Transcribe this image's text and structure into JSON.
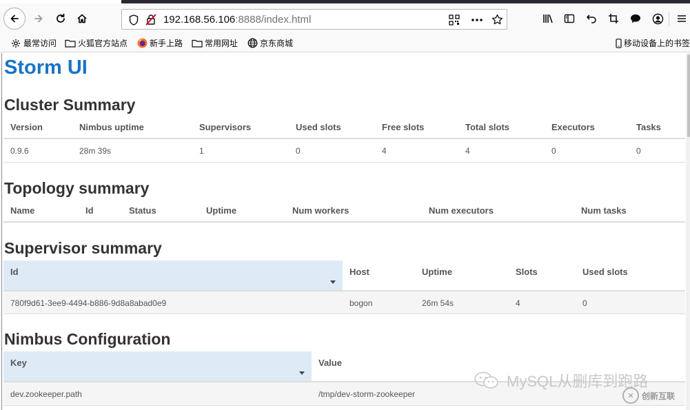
{
  "browser": {
    "url_host": "192.168.56.106",
    "url_rest": ":8888/index.html",
    "icons": [
      "back-icon",
      "forward-icon",
      "reload-icon",
      "home-icon",
      "shield-icon",
      "insecure-lock-icon",
      "qr-code-icon",
      "more-icon",
      "star-icon",
      "library-icon",
      "sidebar-icon",
      "undo-icon",
      "crop-icon",
      "chat-icon",
      "account-icon",
      "menu-icon"
    ]
  },
  "bookmarks": {
    "items": [
      {
        "label": "最常访问",
        "icon": "gear-icon"
      },
      {
        "label": "火狐官方站点",
        "icon": "folder-icon"
      },
      {
        "label": "新手上路",
        "icon": "firefox-icon"
      },
      {
        "label": "常用网址",
        "icon": "folder-icon"
      },
      {
        "label": "京东商城",
        "icon": "globe-icon"
      }
    ],
    "mobile": "移动设备上的书签"
  },
  "page": {
    "title": "Storm UI",
    "cluster": {
      "title": "Cluster Summary",
      "headers": [
        "Version",
        "Nimbus uptime",
        "Supervisors",
        "Used slots",
        "Free slots",
        "Total slots",
        "Executors",
        "Tasks"
      ],
      "row": [
        "0.9.6",
        "28m 39s",
        "1",
        "0",
        "4",
        "4",
        "0",
        "0"
      ]
    },
    "topology": {
      "title": "Topology summary",
      "headers": [
        "Name",
        "Id",
        "Status",
        "Uptime",
        "Num workers",
        "Num executors",
        "Num tasks"
      ]
    },
    "supervisor": {
      "title": "Supervisor summary",
      "headers": [
        "Id",
        "Host",
        "Uptime",
        "Slots",
        "Used slots"
      ],
      "row": [
        "780f9d61-3ee9-4494-b886-9d8a8abad0e9",
        "bogon",
        "26m 54s",
        "4",
        "0"
      ]
    },
    "nimbus": {
      "title": "Nimbus Configuration",
      "headers": [
        "Key",
        "Value"
      ],
      "row": [
        "dev.zookeeper.path",
        "/tmp/dev-storm-zookeeper"
      ]
    }
  },
  "watermark": {
    "text1": "MySQL从删库到跑路",
    "text2": "创新互联"
  },
  "colors": {
    "title_blue": "#1a73c8",
    "sorted_header_bg": "#deebf6",
    "heading_text": "#333333"
  }
}
